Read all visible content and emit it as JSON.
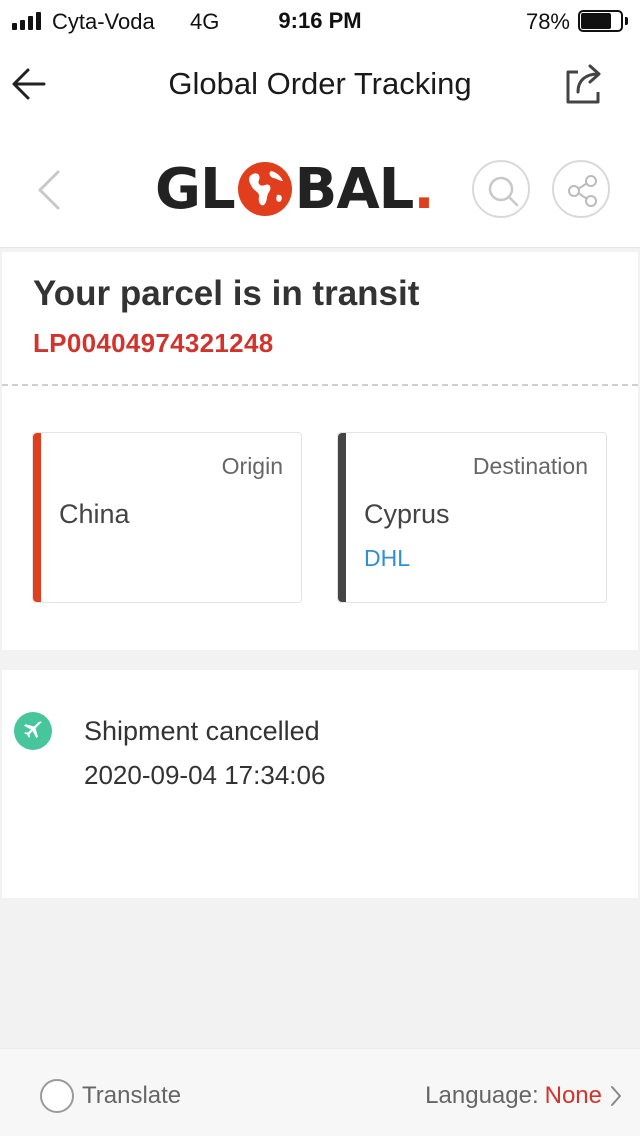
{
  "status_bar": {
    "carrier": "Cyta-Voda",
    "network": "4G",
    "time": "9:16 PM",
    "battery_percent": "78%",
    "battery_level": 0.78
  },
  "nav": {
    "title": "Global Order Tracking",
    "back_icon": "arrow-left-icon",
    "share_icon": "share-export-icon"
  },
  "brand": {
    "logo_text_left": "GL",
    "logo_text_right": "BAL",
    "logo_dot": ".",
    "brand_color": "#e03e1d"
  },
  "tracking": {
    "status": "Your parcel is in transit",
    "number": "LP00404974321248",
    "origin": {
      "caption": "Origin",
      "country": "China",
      "color": "#e03e1d"
    },
    "destination": {
      "caption": "Destination",
      "country": "Cyprus",
      "carrier": "DHL",
      "color": "#454545"
    }
  },
  "events": [
    {
      "title": "Shipment cancelled",
      "time": "2020-09-04 17:34:06",
      "icon": "airplane-icon",
      "color": "#46c69a"
    }
  ],
  "footer": {
    "translate_label": "Translate",
    "language_label": "Language:",
    "language_value": "None"
  }
}
